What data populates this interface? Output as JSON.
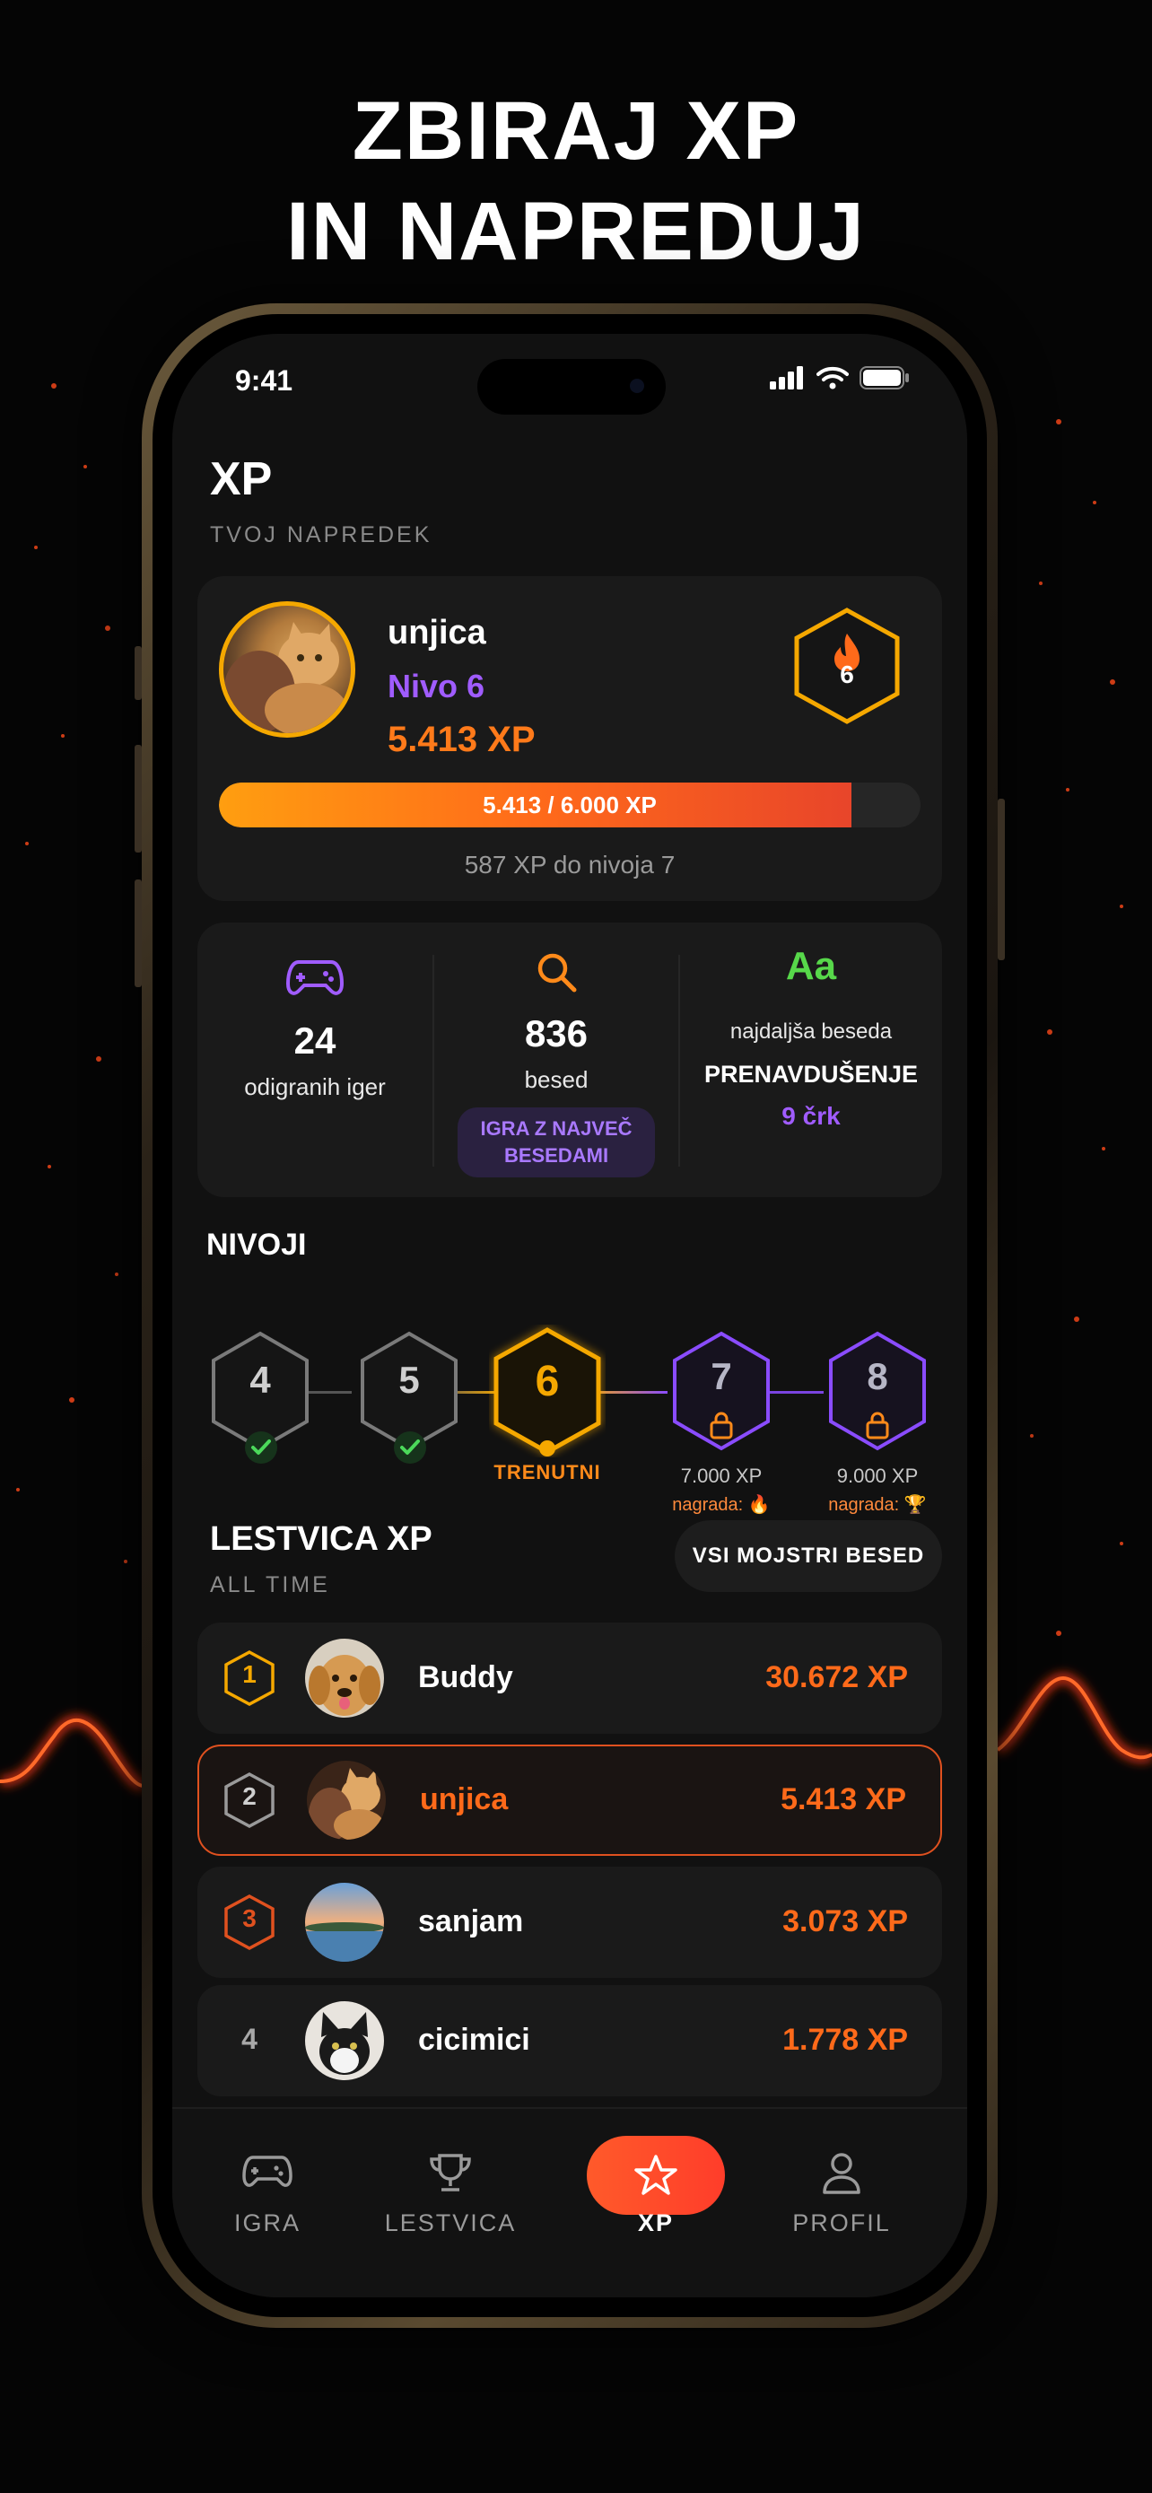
{
  "headline": {
    "line1": "ZBIRAJ XP",
    "line2": "IN NAPREDUJ"
  },
  "status_bar": {
    "time": "9:41"
  },
  "page": {
    "title": "XP",
    "subtitle": "TVOJ NAPREDEK"
  },
  "profile": {
    "username": "unjica",
    "level_label": "Nivo 6",
    "xp_label": "5.413 XP",
    "streak_value": "6",
    "progress_fraction": 0.902,
    "progress_label": "5.413 / 6.000 XP",
    "remaining_label": "587 XP do nivoja 7"
  },
  "stats": {
    "games": {
      "value": "24",
      "label": "odigranih iger"
    },
    "words": {
      "value": "836",
      "label": "besed",
      "chip": "IGRA Z NAJVEČ BESEDAMI"
    },
    "longest": {
      "icon_text": "Aa",
      "label": "najdaljša beseda",
      "word": "PRENAVDUŠENJE",
      "length": "9 črk"
    }
  },
  "levels_section": {
    "title": "NIVOJI",
    "levels": [
      {
        "number": "4",
        "state": "done"
      },
      {
        "number": "5",
        "state": "done"
      },
      {
        "number": "6",
        "state": "current",
        "caption": "TRENUTNI"
      },
      {
        "number": "7",
        "state": "locked",
        "caption": "7.000 XP",
        "reward": "nagrada: 🔥"
      },
      {
        "number": "8",
        "state": "locked",
        "caption": "9.000 XP",
        "reward": "nagrada: 🏆"
      }
    ]
  },
  "leaderboard": {
    "title": "LESTVICA XP",
    "subtitle": "ALL TIME",
    "button_label": "VSI MOJSTRI BESED",
    "rows": [
      {
        "rank": "1",
        "name": "Buddy",
        "xp": "30.672 XP"
      },
      {
        "rank": "2",
        "name": "unjica",
        "xp": "5.413 XP"
      },
      {
        "rank": "3",
        "name": "sanjam",
        "xp": "3.073 XP"
      },
      {
        "rank": "4",
        "name": "cicimici",
        "xp": "1.778 XP"
      }
    ]
  },
  "tabbar": {
    "tabs": [
      {
        "label": "IGRA",
        "icon": "gamepad-icon"
      },
      {
        "label": "LESTVICA",
        "icon": "trophy-icon"
      },
      {
        "label": "XP",
        "icon": "star-icon"
      },
      {
        "label": "PROFIL",
        "icon": "user-icon"
      }
    ]
  },
  "colors": {
    "accent_orange": "#ff6a1a",
    "accent_purple": "#a05cff",
    "gold": "#f5a800"
  }
}
